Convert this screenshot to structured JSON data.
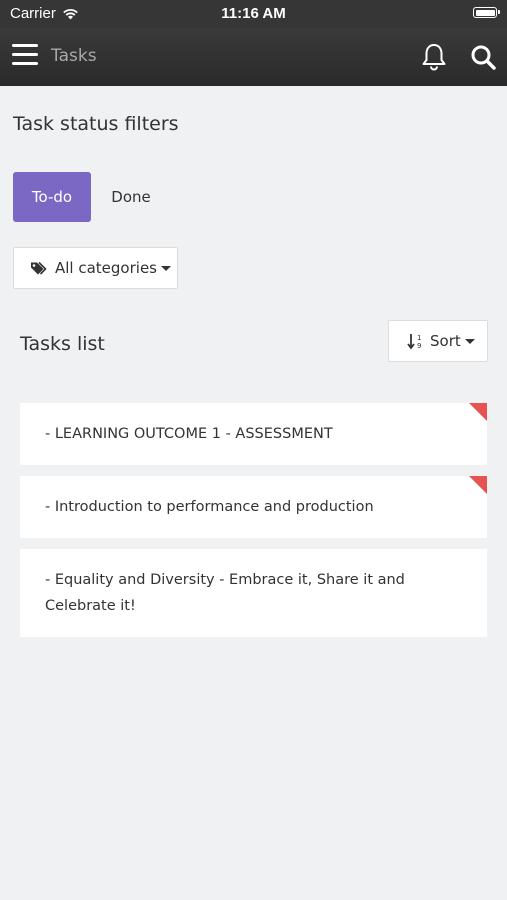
{
  "status_bar": {
    "carrier": "Carrier",
    "time": "11:16 AM",
    "battery_level": 1.0
  },
  "header": {
    "title": "Tasks",
    "icons": [
      "menu-icon",
      "bell-icon",
      "search-icon"
    ]
  },
  "filters": {
    "section_title": "Task status filters",
    "status_options": [
      "To-do",
      "Done"
    ],
    "selected_status": "To-do",
    "todo_label": "To-do",
    "done_label": "Done",
    "categories_label": "All categories"
  },
  "tasks_list": {
    "title": "Tasks list",
    "sort_label": "Sort",
    "items": [
      {
        "label": "- LEARNING OUTCOME 1 - ASSESSMENT",
        "flagged": true
      },
      {
        "label": "- Introduction to performance and production",
        "flagged": true
      },
      {
        "label": "- Equality and Diversity - Embrace it, Share it and Celebrate it!",
        "flagged": false
      }
    ]
  },
  "colors": {
    "header_bg": "#2f2f2f",
    "accent": "#7a68c4",
    "flag": "#e55353",
    "page_bg": "#f0f1f3"
  }
}
